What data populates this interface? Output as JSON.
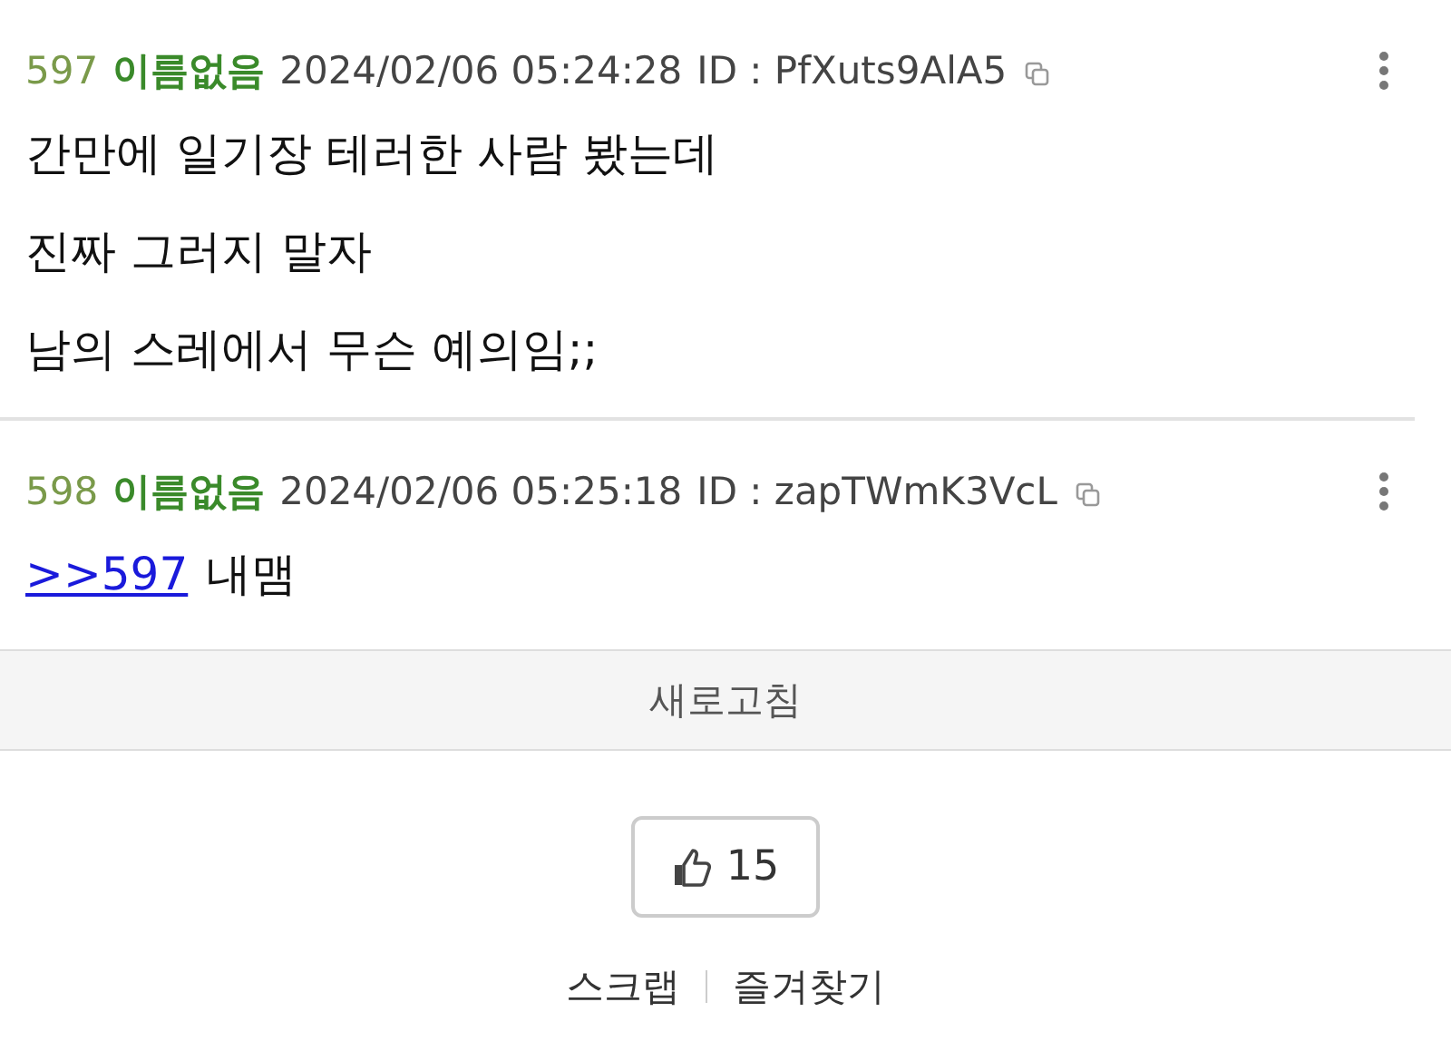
{
  "posts": [
    {
      "number": "597",
      "name": "이름없음",
      "date": "2024/02/06 05:24:28",
      "id": "ID : PfXuts9AlA5",
      "lines": [
        [
          {
            "kind": "text",
            "text": "간만에 일기장 테러한 사람 봤는데"
          }
        ],
        [
          {
            "kind": "text",
            "text": "진짜 그러지 말자"
          }
        ],
        [
          {
            "kind": "text",
            "text": "남의 스레에서 무슨 예의임;;"
          }
        ]
      ]
    },
    {
      "number": "598",
      "name": "이름없음",
      "date": "2024/02/06 05:25:18",
      "id": "ID : zapTWmK3VcL",
      "lines": [
        [
          {
            "kind": "link",
            "text": ">>597"
          },
          {
            "kind": "text",
            "text": "내맴"
          }
        ]
      ]
    }
  ],
  "refresh": "새로고침",
  "like_count": "15",
  "links": [
    "스크랩",
    "즐겨찾기"
  ]
}
